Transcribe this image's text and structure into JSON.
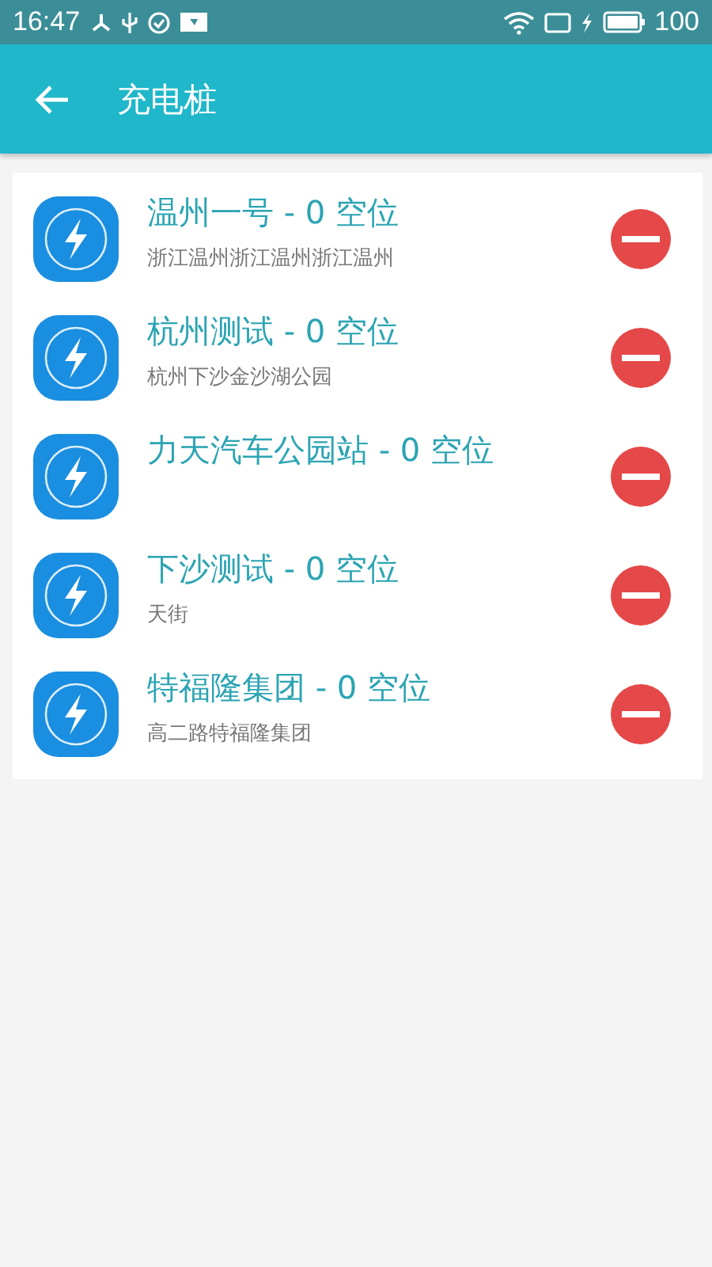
{
  "status_bar": {
    "time": "16:47",
    "battery": "100"
  },
  "app_bar": {
    "title": "充电桩"
  },
  "stations": [
    {
      "name": "温州一号 - 0 空位",
      "address": "浙江温州浙江温州浙江温州"
    },
    {
      "name": "杭州测试 - 0 空位",
      "address": "杭州下沙金沙湖公园"
    },
    {
      "name": "力天汽车公园站 - 0 空位"
    },
    {
      "name": "下沙测试 - 0 空位",
      "address": "天街"
    },
    {
      "name": "特福隆集团 - 0 空位",
      "address": "高二路特福隆集团"
    }
  ]
}
